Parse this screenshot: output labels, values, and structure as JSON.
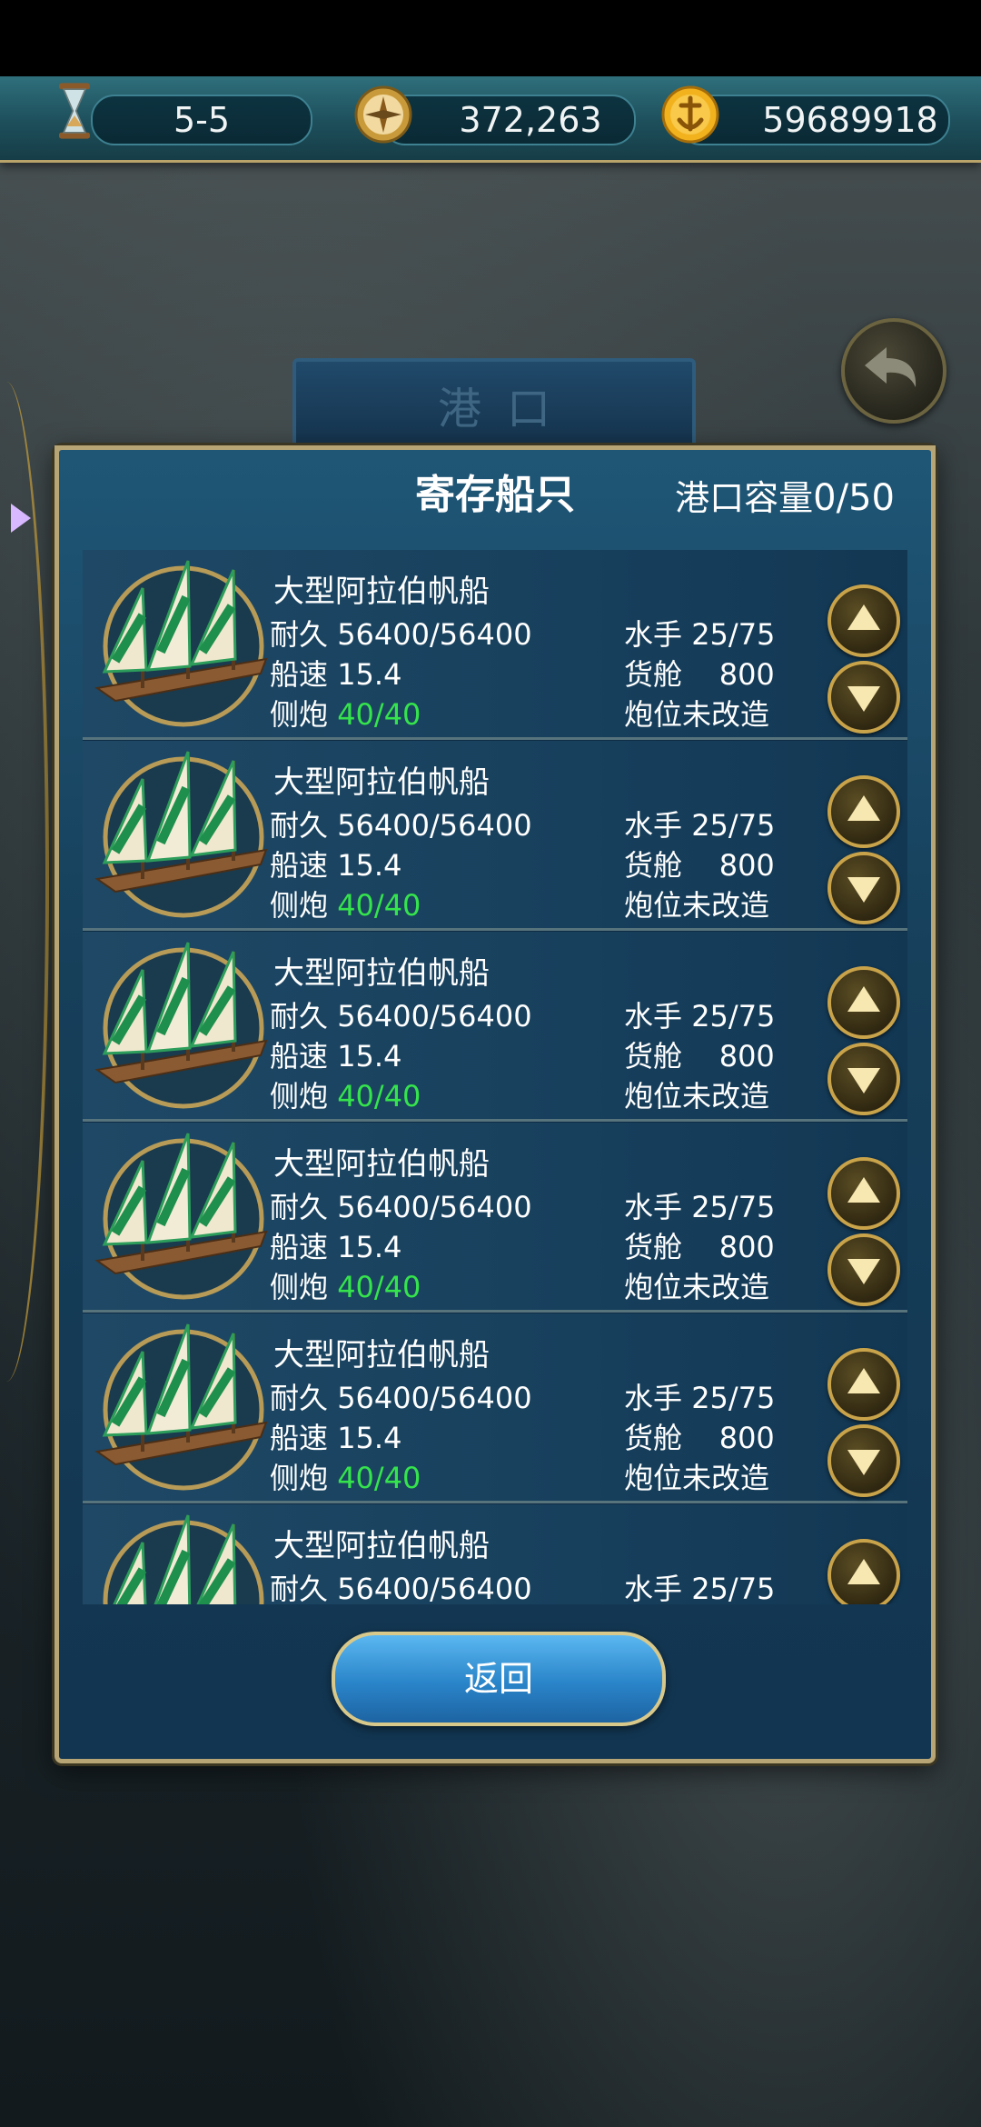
{
  "topbar": {
    "level": "5-5",
    "compass_value": "372,263",
    "gold_value": "59689918",
    "icons": [
      "hourglass-icon",
      "compass-icon",
      "gold-coin-icon"
    ]
  },
  "harbor": {
    "banner": "港口"
  },
  "panel": {
    "title": "寄存船只",
    "capacity_label": "港口容量",
    "capacity_value": "0/50",
    "return_label": "返回"
  },
  "ships": [
    {
      "name": "大型阿拉伯帆船",
      "durability_label": "耐久",
      "durability": "56400/56400",
      "crew_label": "水手",
      "crew": "25/75",
      "speed_label": "船速",
      "speed": "15.4",
      "cargo_label": "货舱",
      "cargo": "800",
      "cannon_label": "侧炮",
      "cannon": "40/40",
      "slot_status": "炮位未改造"
    },
    {
      "name": "大型阿拉伯帆船",
      "durability_label": "耐久",
      "durability": "56400/56400",
      "crew_label": "水手",
      "crew": "25/75",
      "speed_label": "船速",
      "speed": "15.4",
      "cargo_label": "货舱",
      "cargo": "800",
      "cannon_label": "侧炮",
      "cannon": "40/40",
      "slot_status": "炮位未改造"
    },
    {
      "name": "大型阿拉伯帆船",
      "durability_label": "耐久",
      "durability": "56400/56400",
      "crew_label": "水手",
      "crew": "25/75",
      "speed_label": "船速",
      "speed": "15.4",
      "cargo_label": "货舱",
      "cargo": "800",
      "cannon_label": "侧炮",
      "cannon": "40/40",
      "slot_status": "炮位未改造"
    },
    {
      "name": "大型阿拉伯帆船",
      "durability_label": "耐久",
      "durability": "56400/56400",
      "crew_label": "水手",
      "crew": "25/75",
      "speed_label": "船速",
      "speed": "15.4",
      "cargo_label": "货舱",
      "cargo": "800",
      "cannon_label": "侧炮",
      "cannon": "40/40",
      "slot_status": "炮位未改造"
    },
    {
      "name": "大型阿拉伯帆船",
      "durability_label": "耐久",
      "durability": "56400/56400",
      "crew_label": "水手",
      "crew": "25/75",
      "speed_label": "船速",
      "speed": "15.4",
      "cargo_label": "货舱",
      "cargo": "800",
      "cannon_label": "侧炮",
      "cannon": "40/40",
      "slot_status": "炮位未改造"
    },
    {
      "name": "大型阿拉伯帆船",
      "durability_label": "耐久",
      "durability": "56400/56400",
      "crew_label": "水手",
      "crew": "25/75"
    }
  ]
}
